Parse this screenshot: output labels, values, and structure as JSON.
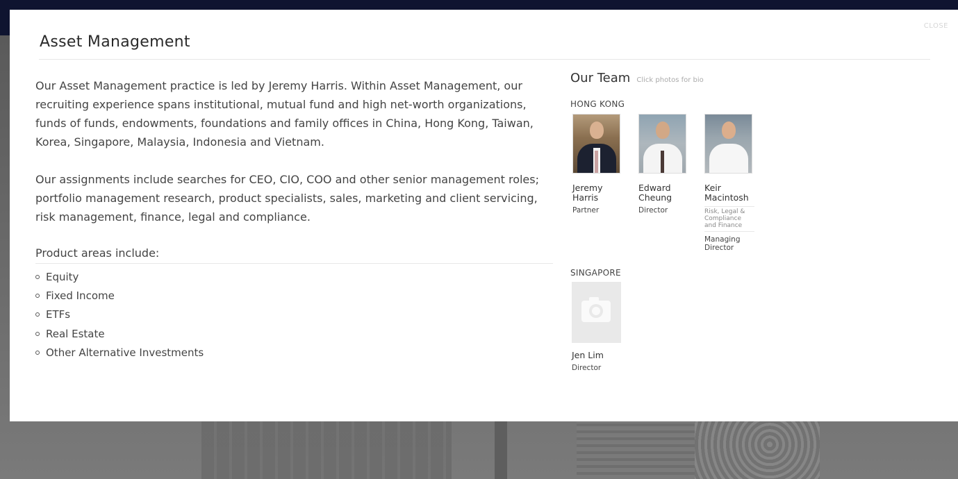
{
  "modal": {
    "title": "Asset Management",
    "close_label": "CLOSE"
  },
  "intro": {
    "paragraphs": [
      "Our Asset Management practice is led by Jeremy Harris. Within Asset Management, our recruiting experience spans institutional, mutual fund and high net-worth organizations, funds of funds, endowments, foundations and family offices in China, Hong Kong, Taiwan, Korea, Singapore, Malaysia, Indonesia and Vietnam.",
      "Our assignments include searches for CEO, CIO, COO and other senior management roles; portfolio management research, product specialists, sales, marketing and client servicing, risk management, finance, legal and compliance."
    ],
    "areas_heading": "Product areas include:",
    "areas": [
      "Equity",
      "Fixed Income",
      "ETFs",
      "Real Estate",
      "Other Alternative Investments"
    ]
  },
  "team": {
    "title": "Our Team",
    "hint": "Click photos for bio",
    "regions": [
      {
        "name": "HONG KONG",
        "members": [
          {
            "name": "Jeremy Harris",
            "role": "Partner"
          },
          {
            "name": "Edward Cheung",
            "role": "Director"
          },
          {
            "name": "Keir Macintosh",
            "department": "Risk, Legal & Compliance and Finance",
            "role": "Managing Director"
          }
        ]
      },
      {
        "name": "SINGAPORE",
        "members": [
          {
            "name": "Jen Lim",
            "role": "Director"
          }
        ]
      }
    ]
  },
  "colors": {
    "header_navy": "#0f1430",
    "text": "#444444"
  }
}
